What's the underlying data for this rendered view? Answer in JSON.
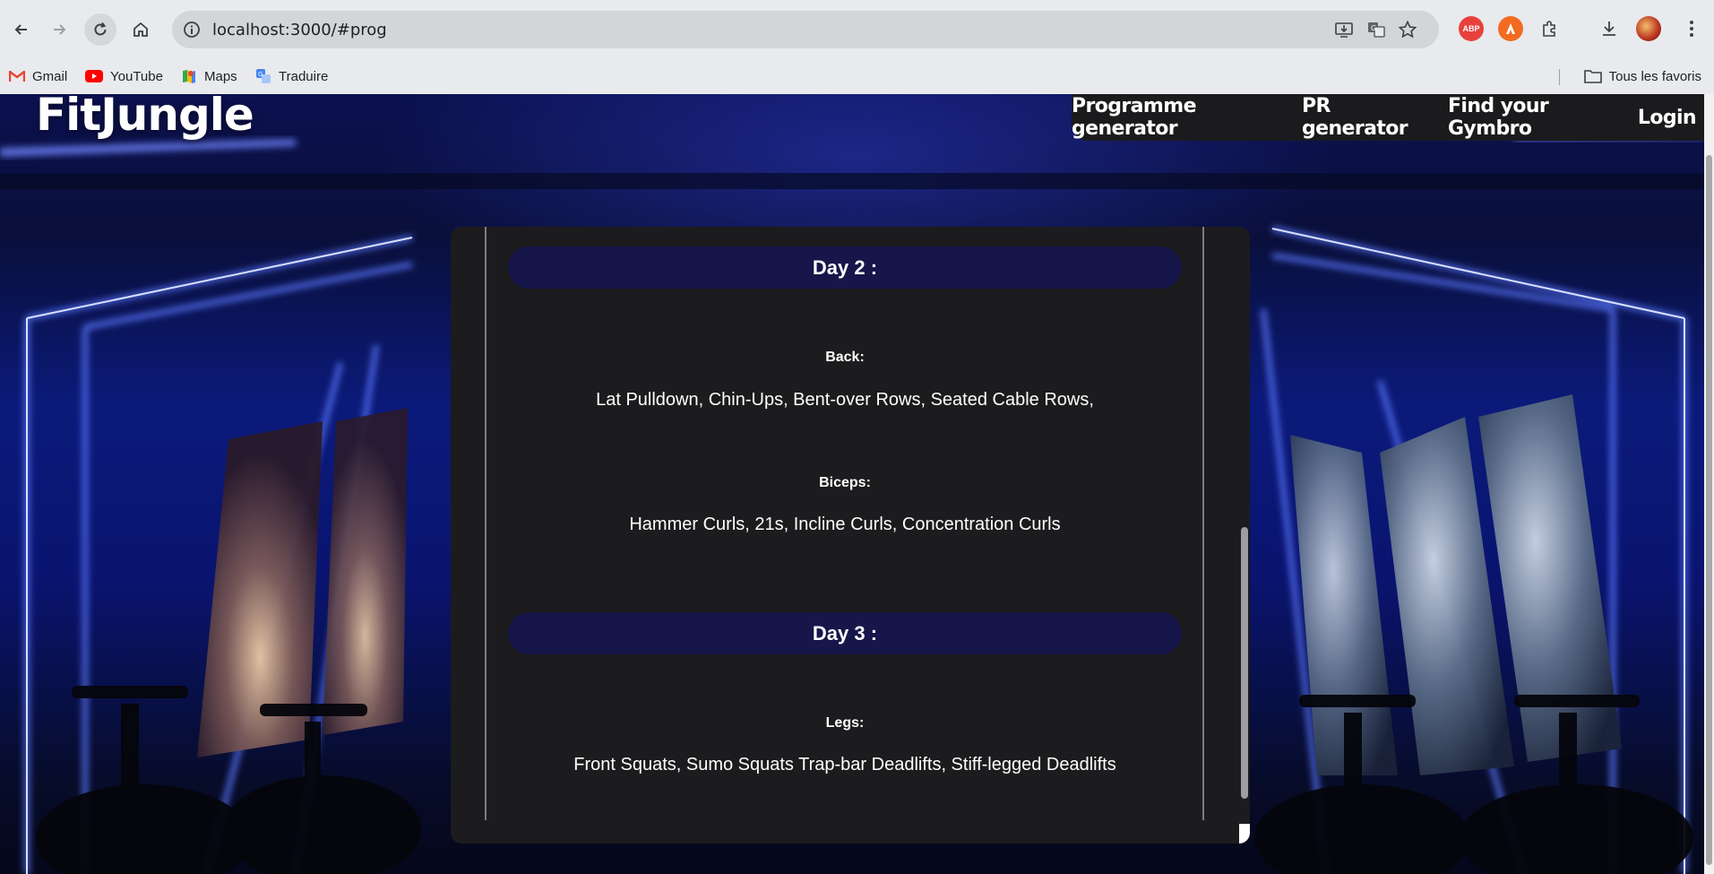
{
  "browser": {
    "url": "localhost:3000/#prog",
    "bookmarks": [
      {
        "label": "Gmail",
        "icon": "gmail-icon"
      },
      {
        "label": "YouTube",
        "icon": "youtube-icon"
      },
      {
        "label": "Maps",
        "icon": "maps-icon"
      },
      {
        "label": "Traduire",
        "icon": "translate-icon"
      }
    ],
    "all_bookmarks_label": "Tous les favoris",
    "extensions": [
      {
        "label": "ABP",
        "color": "#e8413c"
      },
      {
        "icon": "avast-icon",
        "color": "#f26b21"
      }
    ]
  },
  "site": {
    "logo": "FitJungle",
    "nav": [
      "Programme generator",
      "PR generator",
      "Find your Gymbro",
      "Login"
    ]
  },
  "programme": {
    "days": [
      {
        "title": "Day 2 :",
        "groups": [
          {
            "muscle": "Back:",
            "exercises": "Lat Pulldown, Chin-Ups, Bent-over Rows, Seated Cable Rows,"
          },
          {
            "muscle": "Biceps:",
            "exercises": "Hammer Curls, 21s, Incline Curls, Concentration Curls"
          }
        ]
      },
      {
        "title": "Day 3 :",
        "groups": [
          {
            "muscle": "Legs:",
            "exercises": "Front Squats, Sumo Squats Trap-bar Deadlifts, Stiff-legged Deadlifts"
          }
        ]
      }
    ]
  },
  "colors": {
    "card_bg": "#1c1b1d",
    "day_header_bg": "#16164a",
    "nav_bg": "#1b1b1e",
    "neon_blue": "#2b4cff"
  }
}
